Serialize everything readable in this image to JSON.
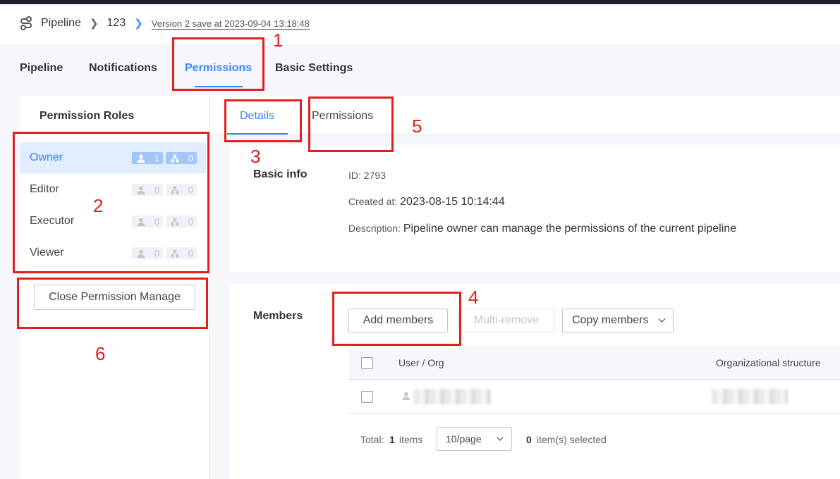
{
  "breadcrumb": {
    "root": "Pipeline",
    "pipeline_name": "123",
    "version": "Version 2 save at 2023-09-04 13:18:48"
  },
  "main_tabs": [
    {
      "label": "Pipeline"
    },
    {
      "label": "Notifications"
    },
    {
      "label": "Permissions",
      "active": true
    },
    {
      "label": "Basic Settings"
    }
  ],
  "left_panel": {
    "title": "Permission Roles",
    "roles": [
      {
        "name": "Owner",
        "users": "1",
        "orgs": "0",
        "active": true
      },
      {
        "name": "Editor",
        "users": "0",
        "orgs": "0"
      },
      {
        "name": "Executor",
        "users": "0",
        "orgs": "0"
      },
      {
        "name": "Viewer",
        "users": "0",
        "orgs": "0"
      }
    ],
    "close_label": "Close Permission Manage"
  },
  "sub_tabs": [
    {
      "label": "Details",
      "active": true
    },
    {
      "label": "Permissions"
    }
  ],
  "basic_info": {
    "label": "Basic info",
    "id_label": "ID:",
    "id_value": "2793",
    "created_label": "Created at:",
    "created_value": "2023-08-15 10:14:44",
    "desc_label": "Description:",
    "desc_value": "Pipeline owner can manage the permissions of the current pipeline"
  },
  "members": {
    "label": "Members",
    "add_label": "Add members",
    "multi_remove_label": "Multi-remove",
    "copy_label": "Copy members",
    "columns": [
      "User / Org",
      "Organizational structure"
    ],
    "footer": {
      "total_label": "Total:",
      "total_count": "1",
      "items_label": "items",
      "page_size": "10/page",
      "selected_count": "0",
      "selected_label": "item(s) selected"
    }
  },
  "annotations": [
    "1",
    "2",
    "3",
    "4",
    "5",
    "6"
  ],
  "colors": {
    "accent": "#3a84ff",
    "annotation": "#e02020",
    "active_role_bg": "#e1ecff"
  },
  "icons": [
    "pipeline-logo-icon",
    "chevron-right-icon",
    "user-icon",
    "org-icon",
    "chevron-down-icon",
    "avatar-icon"
  ]
}
